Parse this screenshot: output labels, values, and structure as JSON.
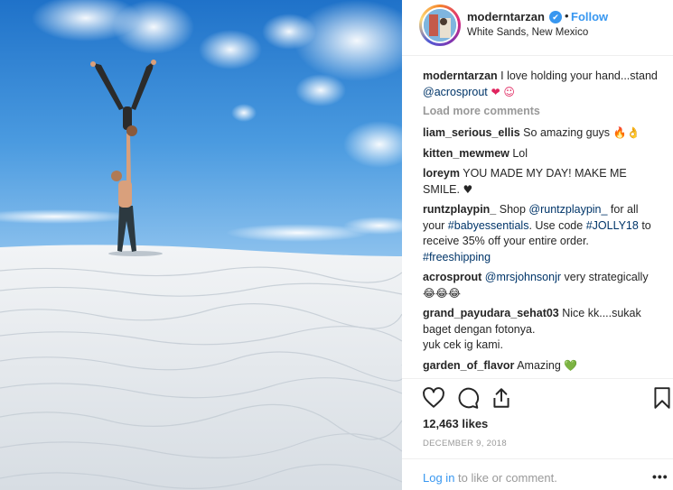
{
  "header": {
    "username": "moderntarzan",
    "verified_glyph": "✔",
    "separator": "•",
    "follow_label": "Follow",
    "location": "White Sands, New Mexico",
    "avatar_icon": "avatar-photo"
  },
  "caption": {
    "user": "moderntarzan",
    "text": " I love holding your hand...stand ",
    "mention": "@acrosprout",
    "emoji": " ❤ ☺"
  },
  "load_more": "Load more comments",
  "comments": [
    {
      "user": "liam_serious_ellis",
      "text": " So amazing guys ",
      "emoji": "🔥👌"
    },
    {
      "user": "kitten_mewmew",
      "text": " Lol",
      "emoji": ""
    },
    {
      "user": "loreym",
      "text": " YOU MADE MY DAY! MAKE ME SMILE. ",
      "emoji": "♥"
    },
    {
      "user": "runtzplaypin_",
      "text": " Shop ",
      "mention": "@runtzplaypin_",
      "text2": " for all your ",
      "tag1": "#babyessentials",
      "text3": ". Use code ",
      "tag2": "#JOLLY18",
      "text4": " to receive 35% off your entire order. ",
      "tag3": "#freeshipping"
    },
    {
      "user": "acrosprout",
      "text": " ",
      "mention": "@mrsjohnsonjr",
      "text2": " very strategically ",
      "emoji": "😂😂😂"
    },
    {
      "user": "grand_payudara_sehat03",
      "text": " Nice kk....sukak baget dengan fotonya.",
      "text2": "yuk cek ig kami."
    },
    {
      "user": "garden_of_flavor",
      "text": " Amazing ",
      "emoji": "💚"
    }
  ],
  "actions": {
    "like_icon": "heart-outline",
    "comment_icon": "speech-bubble",
    "share_icon": "share-upload",
    "save_icon": "bookmark"
  },
  "likes": "12,463 likes",
  "date": "DECEMBER 9, 2018",
  "login": {
    "link": "Log in",
    "rest": " to like or comment."
  },
  "more_glyph": "•••",
  "colors": {
    "link": "#3897f0",
    "muted": "#999999",
    "text": "#262626",
    "mention": "#003569"
  }
}
